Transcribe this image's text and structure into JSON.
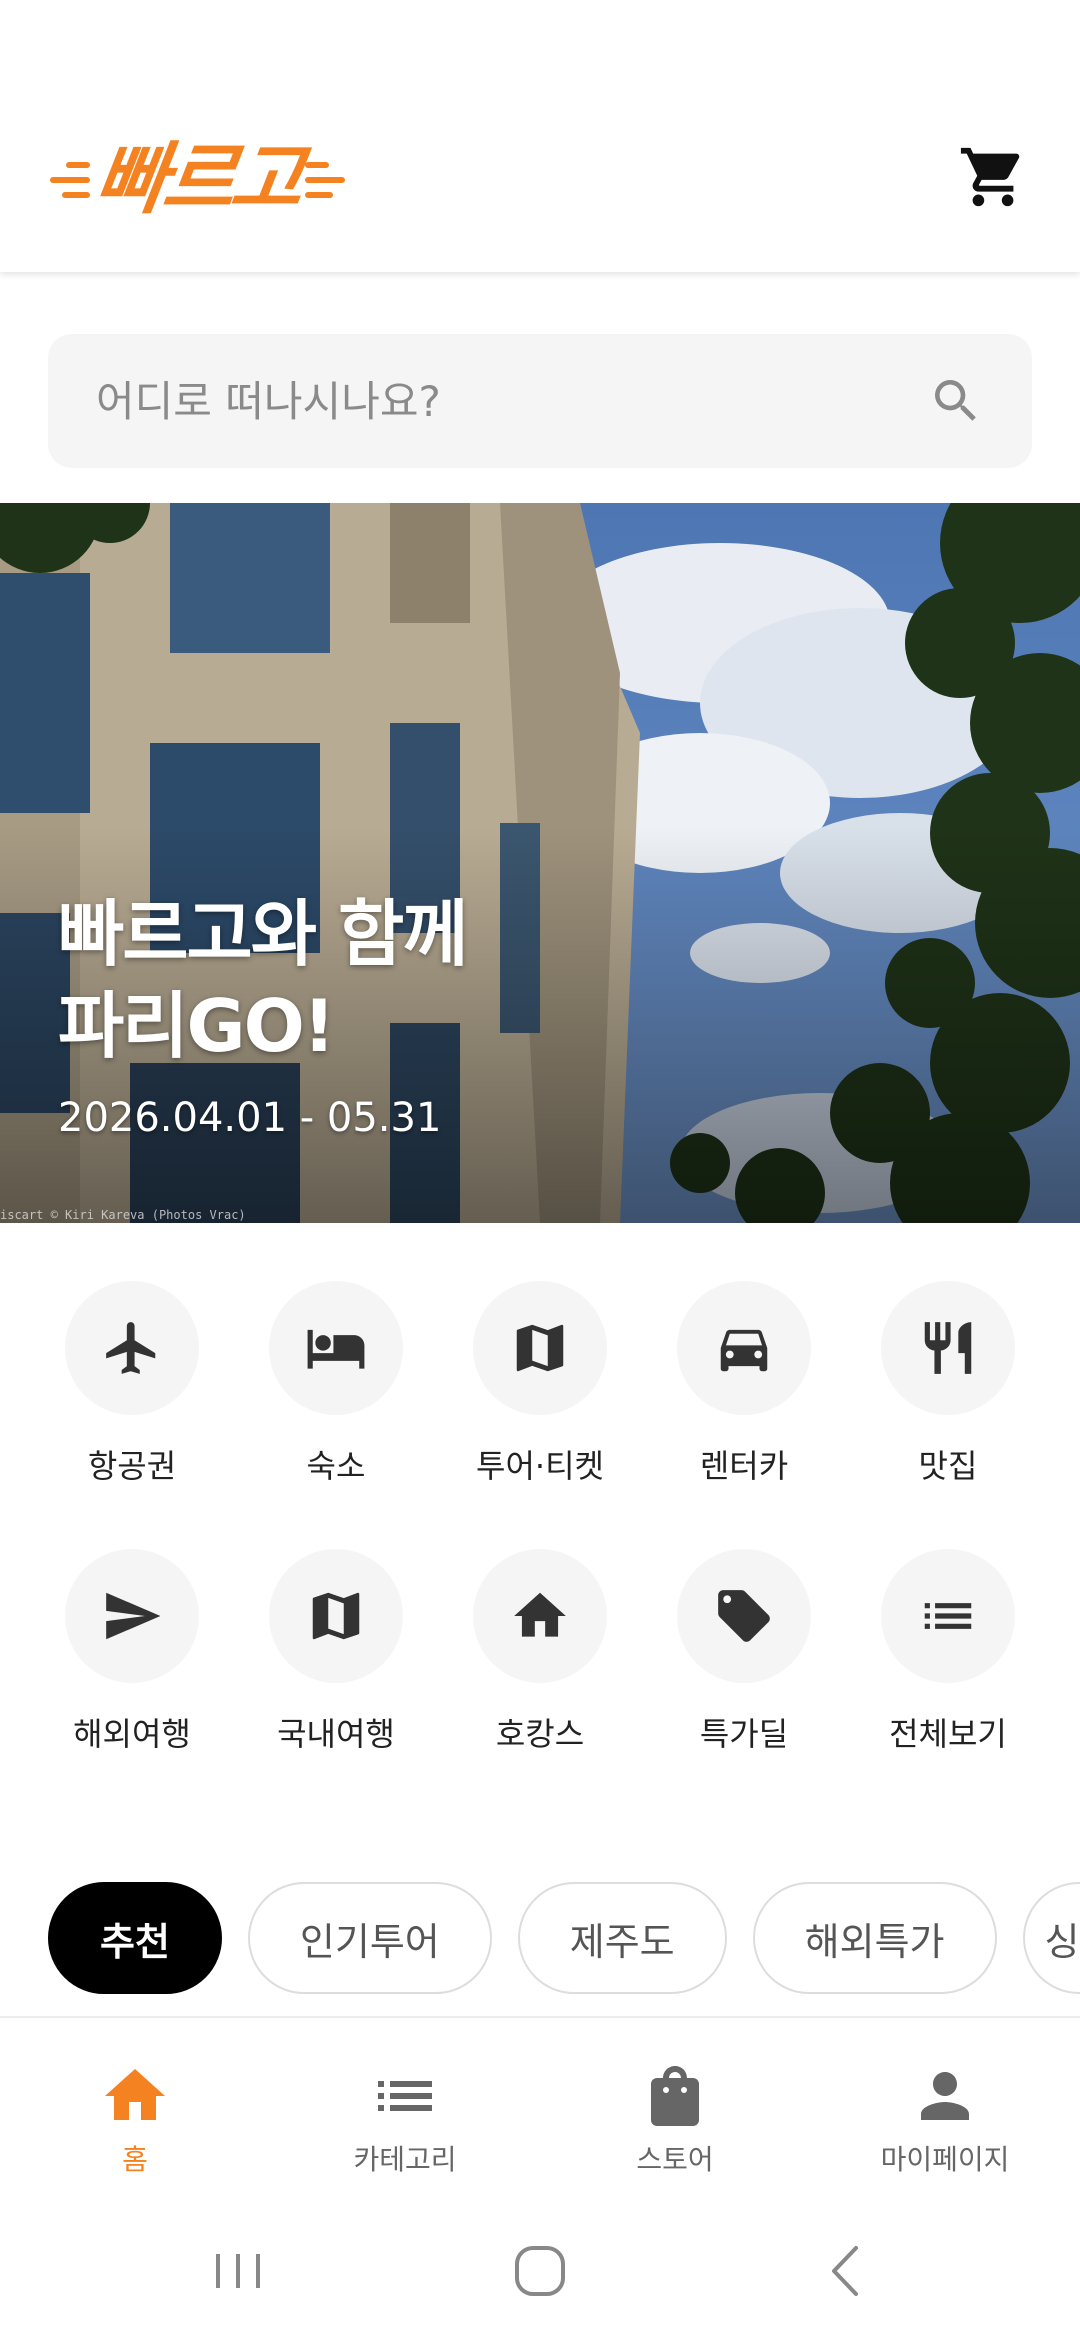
{
  "header": {
    "logo_text": "빠르고"
  },
  "search": {
    "placeholder": "어디로 떠나시나요?"
  },
  "banner": {
    "title_line1": "빠르고와 함께",
    "title_line2": "파리GO!",
    "date": "2026.04.01 - 05.31",
    "credit": "iscart © Kiri Kareva (Photos Vrac)"
  },
  "categories": [
    {
      "label": "항공권",
      "icon": "airplane-icon"
    },
    {
      "label": "숙소",
      "icon": "bed-icon"
    },
    {
      "label": "투어·티켓",
      "icon": "map-icon"
    },
    {
      "label": "렌터카",
      "icon": "car-icon"
    },
    {
      "label": "맛집",
      "icon": "restaurant-icon"
    },
    {
      "label": "해외여행",
      "icon": "send-icon"
    },
    {
      "label": "국내여행",
      "icon": "map-icon"
    },
    {
      "label": "호캉스",
      "icon": "home-icon"
    },
    {
      "label": "특가딜",
      "icon": "tag-icon"
    },
    {
      "label": "전체보기",
      "icon": "list-icon"
    }
  ],
  "chips": [
    "추천",
    "인기투어",
    "제주도",
    "해외특가",
    "싱"
  ],
  "bottom_nav": [
    {
      "label": "홈",
      "icon": "home-icon",
      "active": true
    },
    {
      "label": "카테고리",
      "icon": "list-icon"
    },
    {
      "label": "스토어",
      "icon": "shopping-bag-icon"
    },
    {
      "label": "마이페이지",
      "icon": "person-icon"
    }
  ],
  "colors": {
    "accent": "#F58220",
    "icon_dark": "#333333",
    "chip_active_bg": "#000000",
    "surface": "#f5f5f5"
  }
}
